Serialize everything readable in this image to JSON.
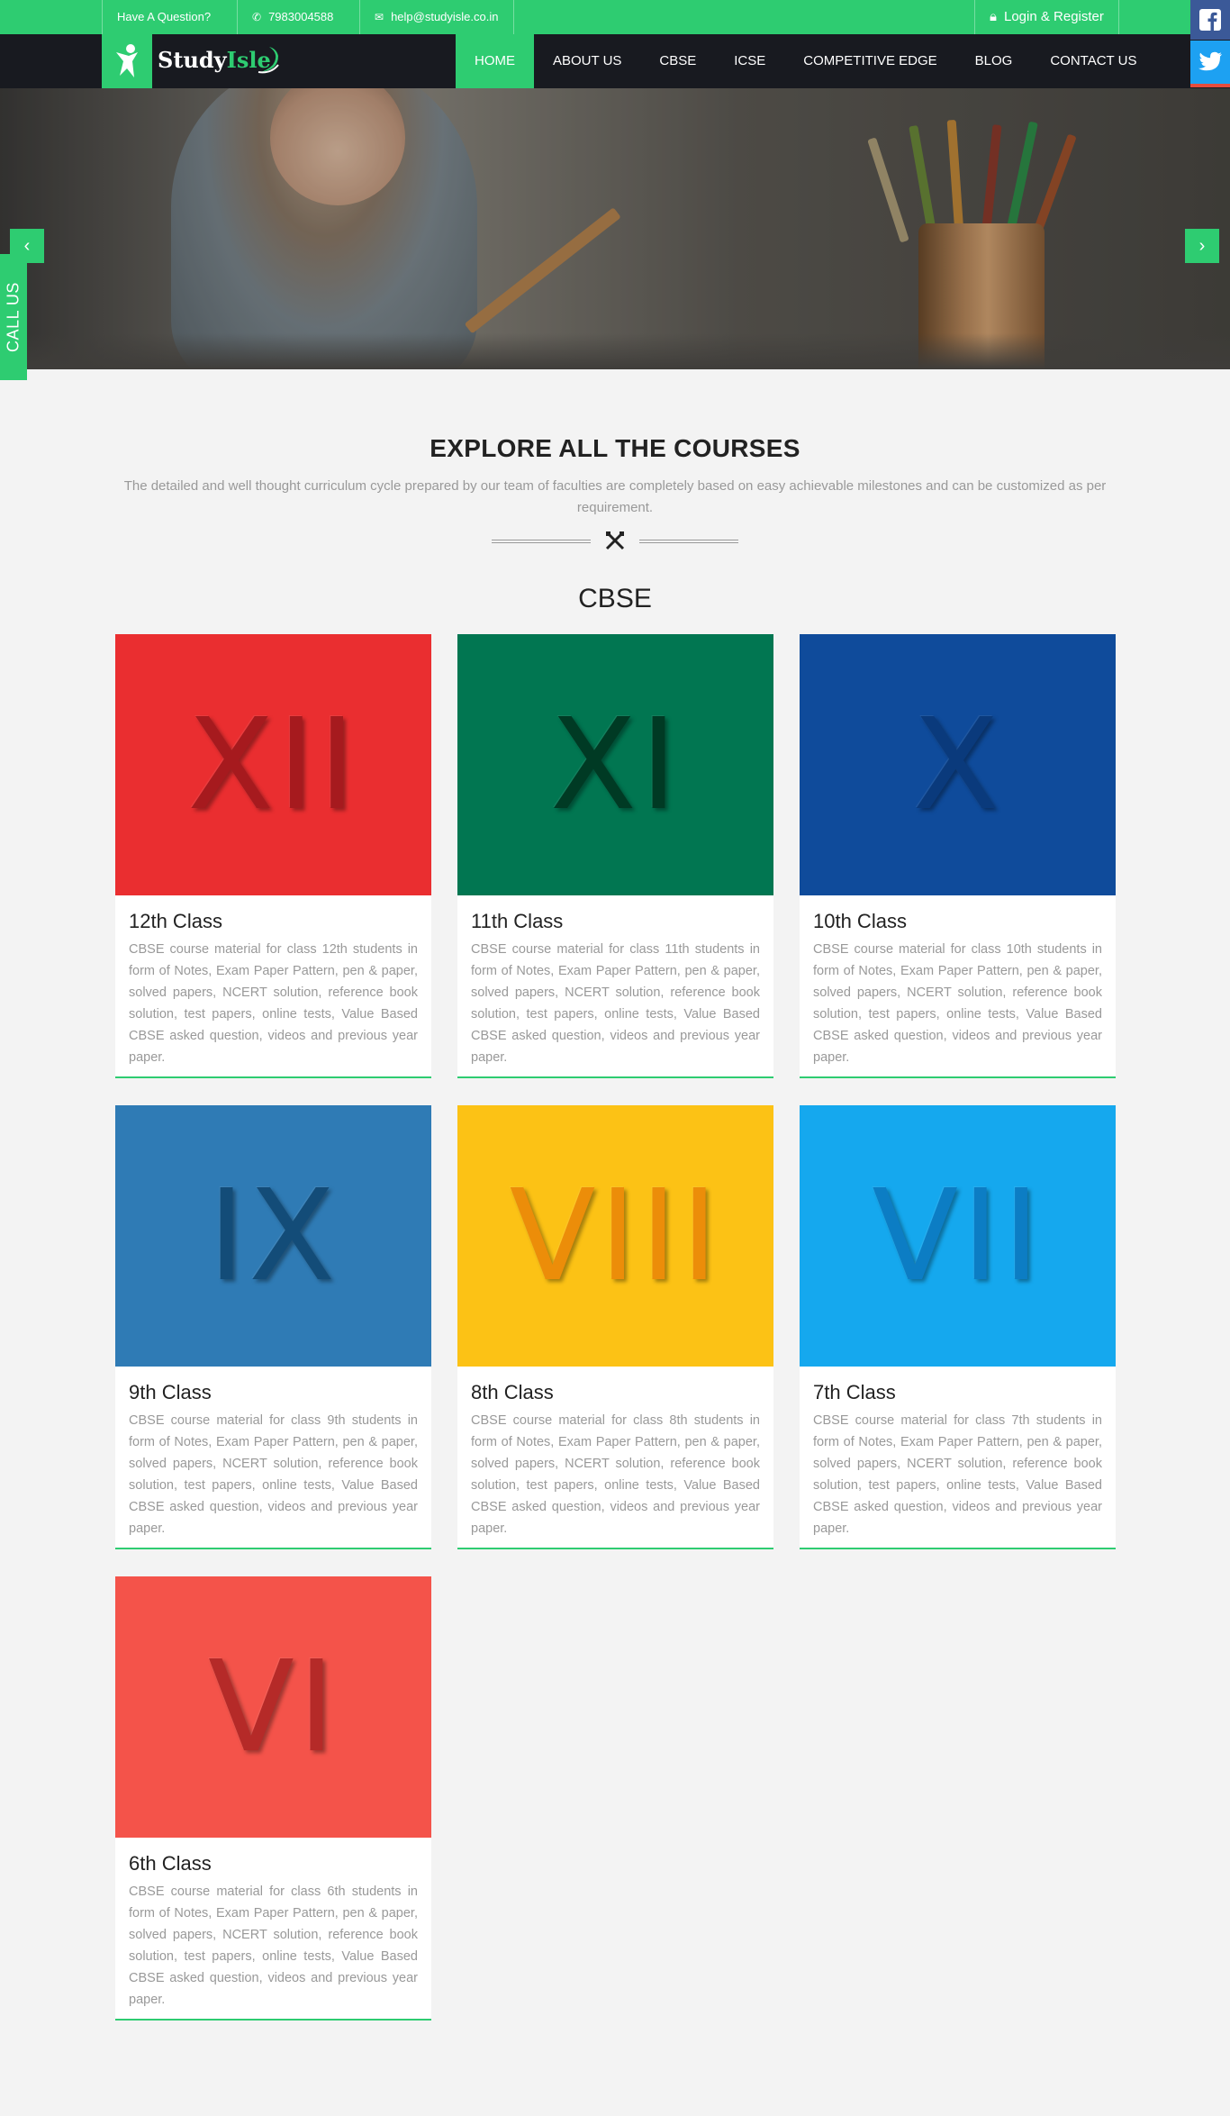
{
  "topbar": {
    "question": "Have A Question?",
    "phone": "7983004588",
    "email": "help@studyisle.co.in",
    "login": "Login & Register"
  },
  "logo": {
    "text_primary": "Study",
    "text_accent": "Isle"
  },
  "nav": {
    "items": [
      {
        "label": "HOME",
        "active": true
      },
      {
        "label": "ABOUT US",
        "active": false
      },
      {
        "label": "CBSE",
        "active": false
      },
      {
        "label": "ICSE",
        "active": false
      },
      {
        "label": "COMPETITIVE EDGE",
        "active": false
      },
      {
        "label": "BLOG",
        "active": false
      },
      {
        "label": "CONTACT US",
        "active": false
      }
    ]
  },
  "social": {
    "facebook": "facebook-icon",
    "twitter": "twitter-icon"
  },
  "callus": "CALL US",
  "section": {
    "title": "EXPLORE ALL THE COURSES",
    "description": "The detailed and well thought curriculum cycle prepared by our team of faculties are completely based on easy achievable milestones and can be customized as per requirement.",
    "subtitle": "CBSE"
  },
  "courses": [
    {
      "roman": "XII",
      "title": "12th Class",
      "color": "#ea2e30",
      "text_color": "#a61a1e",
      "desc": "CBSE course material for class 12th students in form of Notes, Exam Paper Pattern, pen & paper, solved papers, NCERT solution, reference book solution, test papers, online tests, Value Based CBSE asked question, videos and previous year paper."
    },
    {
      "roman": "XI",
      "title": "11th Class",
      "color": "#017651",
      "text_color": "#003a24",
      "desc": "CBSE course material for class 11th students in form of Notes, Exam Paper Pattern, pen & paper, solved papers, NCERT solution, reference book solution, test papers, online tests, Value Based CBSE asked question, videos and previous year paper."
    },
    {
      "roman": "X",
      "title": "10th Class",
      "color": "#0f4b9b",
      "text_color": "#0a3a7c",
      "desc": "CBSE course material for class 10th students in form of Notes, Exam Paper Pattern, pen & paper, solved papers, NCERT solution, reference book solution, test papers, online tests, Value Based CBSE asked question, videos and previous year paper."
    },
    {
      "roman": "IX",
      "title": "9th Class",
      "color": "#2f7bb5",
      "text_color": "#134c78",
      "desc": "CBSE course material for class 9th students in form of Notes, Exam Paper Pattern, pen & paper, solved papers, NCERT solution, reference book solution, test papers, online tests, Value Based CBSE asked question, videos and previous year paper."
    },
    {
      "roman": "VIII",
      "title": "8th Class",
      "color": "#fcc215",
      "text_color": "#ec8d09",
      "desc": "CBSE course material for class 8th students in form of Notes, Exam Paper Pattern, pen & paper, solved papers, NCERT solution, reference book solution, test papers, online tests, Value Based CBSE asked question, videos and previous year paper."
    },
    {
      "roman": "VII",
      "title": "7th Class",
      "color": "#15a8ee",
      "text_color": "#0c7dc4",
      "desc": "CBSE course material for class 7th students in form of Notes, Exam Paper Pattern, pen & paper, solved papers, NCERT solution, reference book solution, test papers, online tests, Value Based CBSE asked question, videos and previous year paper."
    },
    {
      "roman": "VI",
      "title": "6th Class",
      "color": "#f4534a",
      "text_color": "#b52a28",
      "desc": "CBSE course material for class 6th students in form of Notes, Exam Paper Pattern, pen & paper, solved papers, NCERT solution, reference book solution, test papers, online tests, Value Based CBSE asked question, videos and previous year paper."
    }
  ]
}
